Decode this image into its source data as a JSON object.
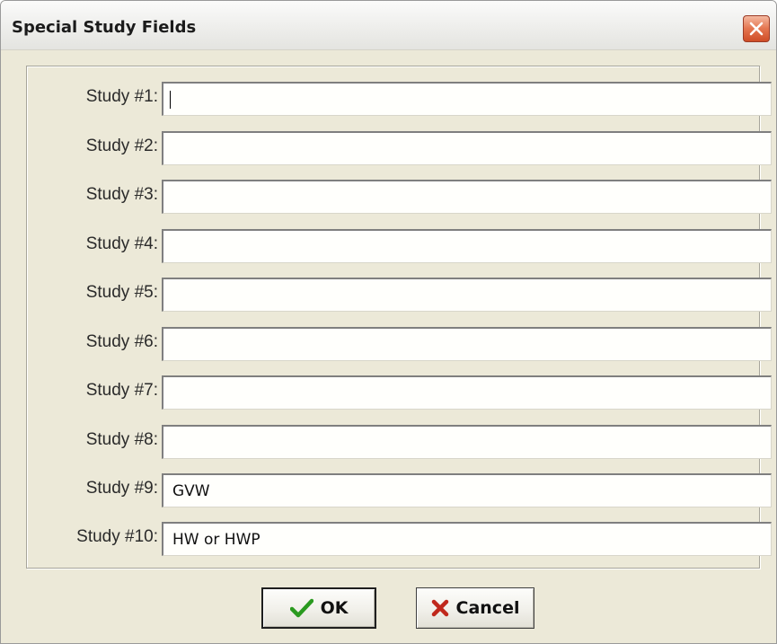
{
  "window": {
    "title": "Special Study Fields"
  },
  "fields": [
    {
      "label": "Study #1:",
      "value": "",
      "focused": true
    },
    {
      "label": "Study #2:",
      "value": ""
    },
    {
      "label": "Study #3:",
      "value": ""
    },
    {
      "label": "Study #4:",
      "value": ""
    },
    {
      "label": "Study #5:",
      "value": ""
    },
    {
      "label": "Study #6:",
      "value": ""
    },
    {
      "label": "Study #7:",
      "value": ""
    },
    {
      "label": "Study #8:",
      "value": ""
    },
    {
      "label": "Study #9:",
      "value": "GVW"
    },
    {
      "label": "Study #10:",
      "value": "HW or HWP"
    }
  ],
  "buttons": {
    "ok": {
      "label": "OK",
      "icon": "checkmark-icon",
      "icon_color": "#2a9a1f"
    },
    "cancel": {
      "label": "Cancel",
      "icon": "x-icon",
      "icon_color": "#c0281c"
    }
  },
  "colors": {
    "close_button": "#d9582f",
    "dialog_background": "#ece9d8"
  }
}
